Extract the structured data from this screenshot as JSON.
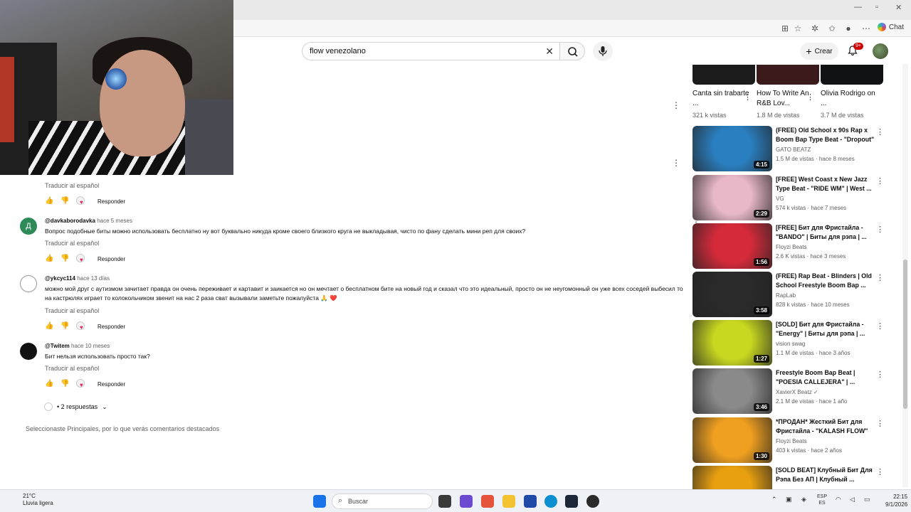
{
  "browser": {
    "chat_label": "Chat"
  },
  "header": {
    "search_value": "flow venezolano",
    "create_label": "Crear",
    "notifications_count": "9+"
  },
  "comments": [
    {
      "handle": "",
      "time": "",
      "text": "",
      "translate": "Traducir al español",
      "reply": "Responder"
    },
    {
      "handle": "@davkaborodavka",
      "time": "hace 5 meses",
      "avatar_letter": "Д",
      "text": "Вопрос подобные биты можно использовать бесплатно ну вот буквально никуда кроме своего близкого круга не выкладывая, чисто по фану сделать мини реп для своих?",
      "translate": "Traducir al español",
      "reply": "Responder"
    },
    {
      "handle": "@ykcyc114",
      "time": "hace 13 días",
      "text": "можно мой друг с аутизмом зачитает правда он очень переживает и картавит и заикается но он мечтает о бесплатном бите на новый год и сказал что это идеальный, просто он не неугомонный он уже всех соседей выбесил то на кастрюлях играет то колокольчиком звенит на нас 2 раза сват вызывали заметьте пожалуйста 🙏 ❤️",
      "translate": "Traducir al español",
      "reply": "Responder"
    },
    {
      "handle": "@Twitem",
      "time": "hace 10 meses",
      "text": "Бит нельзя использовать просто так?",
      "translate": "Traducir al español",
      "reply": "Responder",
      "replies_label": "• 2 respuestas"
    }
  ],
  "sort_note": "Seleccionaste Principales, por lo que verás comentarios destacados",
  "shorts": [
    {
      "title": "Canta sin trabarte ...",
      "views": "321 k vistas"
    },
    {
      "title": "How To Write An R&B Lov...",
      "views": "1.8 M de vistas"
    },
    {
      "title": "Olivia Rodrigo on ...",
      "views": "3.7 M de vistas"
    }
  ],
  "videos": [
    {
      "title": "(FREE) Old School x 90s Rap x Boom Bap Type Beat - \"Dropout\"",
      "channel": "GATO BEATZ",
      "stats": "1.5 M de vistas · hace 8 meses",
      "duration": "4:15",
      "color": "#2a7fc0"
    },
    {
      "title": "[FREE] West Coast x New Jazz Type Beat - \"RIDE WM\" | West ...",
      "channel": "VG",
      "stats": "574 k vistas · hace 7 meses",
      "duration": "2:29",
      "color": "#e8b8c8"
    },
    {
      "title": "[FREE] Бит для Фристайла - \"BANDO\" | Биты для рэпа | ...",
      "channel": "Floyzi Beats",
      "stats": "2.6 K vistas · hace 3 meses",
      "duration": "1:56",
      "color": "#d42a3a"
    },
    {
      "title": "(FREE) Rap Beat - Blinders | Old School Freestyle Boom Bap ...",
      "channel": "RapLab",
      "stats": "828 k vistas · hace 10 meses",
      "duration": "3:58",
      "color": "#2a2a2a"
    },
    {
      "title": "[SOLD] Бит для Фристайла - \"Energy\" | Биты для рэпа | ...",
      "channel": "vision swag",
      "stats": "1.1 M de vistas · hace 3 años",
      "duration": "1:27",
      "color": "#c8d820"
    },
    {
      "title": "Freestyle Boom Bap Beat | \"POESIA CALLEJERA\" | ...",
      "channel": "XavierX Beatz ✓",
      "stats": "2.1 M de vistas · hace 1 año",
      "duration": "3:46",
      "color": "#8a8a8a"
    },
    {
      "title": "*ПРОДАН* Жесткий Бит для Фристайла - \"KALASH FLOW\"",
      "channel": "Floyzi Beats",
      "stats": "403 k vistas · hace 2 años",
      "duration": "1:30",
      "color": "#f0a020"
    },
    {
      "title": "[SOLD BEAT] Клубный Бит Для Рэпа Без АП | Клубный ...",
      "channel": "",
      "stats": "",
      "duration": "",
      "color": "#e8a010"
    }
  ],
  "taskbar": {
    "weather_temp": "21°C",
    "weather_desc": "Lluvia ligera",
    "search_label": "Buscar",
    "lang": "ESP",
    "lang2": "ES",
    "time": "22:15",
    "date": "9/1/2026"
  }
}
